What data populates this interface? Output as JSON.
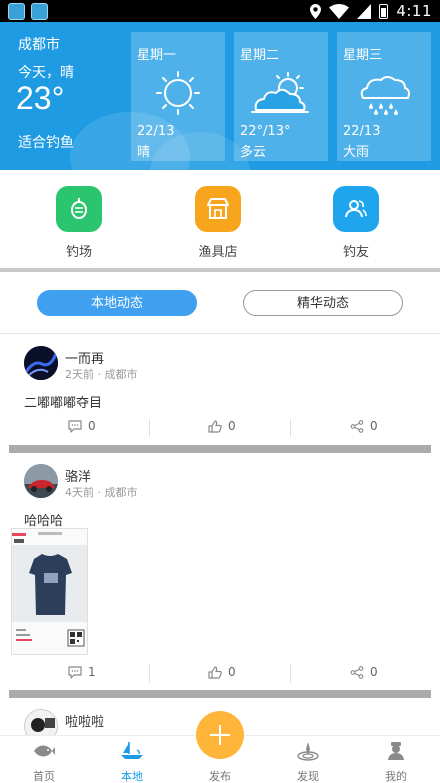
{
  "status_bar": {
    "time": "4:11"
  },
  "weather": {
    "city": "成都市",
    "today": "今天，晴",
    "temp": "23°",
    "tip": "适合钓鱼",
    "forecast": [
      {
        "day": "星期一",
        "range": "22/13",
        "condition": "晴",
        "icon": "sun-icon"
      },
      {
        "day": "星期二",
        "range": "22°/13°",
        "condition": "多云",
        "icon": "partly-cloudy-icon"
      },
      {
        "day": "星期三",
        "range": "22/13",
        "condition": "大雨",
        "icon": "rain-icon"
      }
    ]
  },
  "quick_entries": [
    {
      "label": "钓场",
      "icon": "fishing-spot-icon",
      "color": "#2cc56f"
    },
    {
      "label": "渔具店",
      "icon": "tackle-shop-icon",
      "color": "#f7a51c"
    },
    {
      "label": "钓友",
      "icon": "friends-icon",
      "color": "#1ea5ee"
    }
  ],
  "feed_tabs": {
    "local": "本地动态",
    "featured": "精华动态"
  },
  "posts": [
    {
      "name": "一而再",
      "meta": "2天前 · 成都市",
      "text": "二嘟嘟嘟夺目",
      "comments": "0",
      "likes": "0",
      "shares": "0"
    },
    {
      "name": "骆洋",
      "meta": "4天前 · 成都市",
      "text": "哈哈哈",
      "comments": "1",
      "likes": "0",
      "shares": "0"
    },
    {
      "name": "啦啦啦"
    }
  ],
  "bottom_nav": [
    {
      "label": "首页",
      "icon": "fish-icon"
    },
    {
      "label": "本地",
      "icon": "boat-icon"
    },
    {
      "label": "发布",
      "icon": "plus-icon"
    },
    {
      "label": "发现",
      "icon": "discover-icon"
    },
    {
      "label": "我的",
      "icon": "profile-icon"
    }
  ],
  "colors": {
    "primary": "#1e9be3",
    "tab_active": "#3fa0f0",
    "fab": "#ffb43a"
  }
}
